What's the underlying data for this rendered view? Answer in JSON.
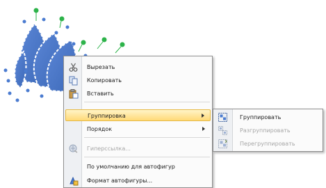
{
  "context_menu": {
    "cut_label": "Вырезать",
    "copy_label": "Копировать",
    "paste_label": "Вставить",
    "grouping_label": "Группировка",
    "order_label": "Порядок",
    "hyperlink_label": "Гиперссылка...",
    "default_autoshape_label": "По умолчанию для автофигур",
    "format_autoshape_label": "Формат автофигуры..."
  },
  "submenu": {
    "group_label": "Группировать",
    "ungroup_label": "Разгруппировать",
    "regroup_label": "Перегруппировать"
  },
  "colors": {
    "shape_fill": "#4472c4",
    "handle_green": "#2db34a",
    "highlight": "#ffd977"
  }
}
